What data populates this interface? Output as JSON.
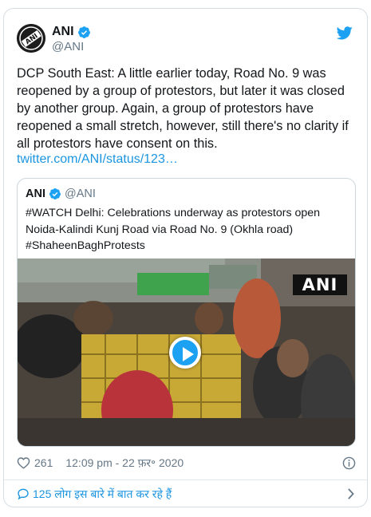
{
  "tweet": {
    "author": {
      "name": "ANI",
      "handle": "@ANI",
      "avatar_text": "ANI"
    },
    "text": "DCP South East: A little earlier today, Road No. 9 was reopened by a group of protestors, but later it was closed by another group. Again, a group of protestors have reopened a small stretch, however, still there's no clarity if all protestors have consent on this.",
    "link_text": "twitter.com/ANI/status/123…",
    "quote": {
      "name": "ANI",
      "handle": "@ANI",
      "text": "#WATCH Delhi: Celebrations underway as protestors open Noida-Kalindi Kunj Road via Road No. 9 (Okhla road) #ShaheenBaghProtests",
      "video": {
        "watermark": "ANI"
      }
    },
    "likes": "261",
    "timestamp": "12:09 pm - 22 फ़र॰ 2020",
    "footer_text": "125 लोग इस बारे में बात कर रहे हैं"
  },
  "colors": {
    "link": "#1b95e0",
    "twitter_blue": "#1da1f2",
    "secondary_text": "#657786",
    "border": "#ccd6dd"
  },
  "icons": [
    "twitter-bird-icon",
    "verified-badge-icon",
    "heart-icon",
    "info-icon",
    "speech-bubble-icon",
    "chevron-right-icon",
    "play-icon"
  ]
}
